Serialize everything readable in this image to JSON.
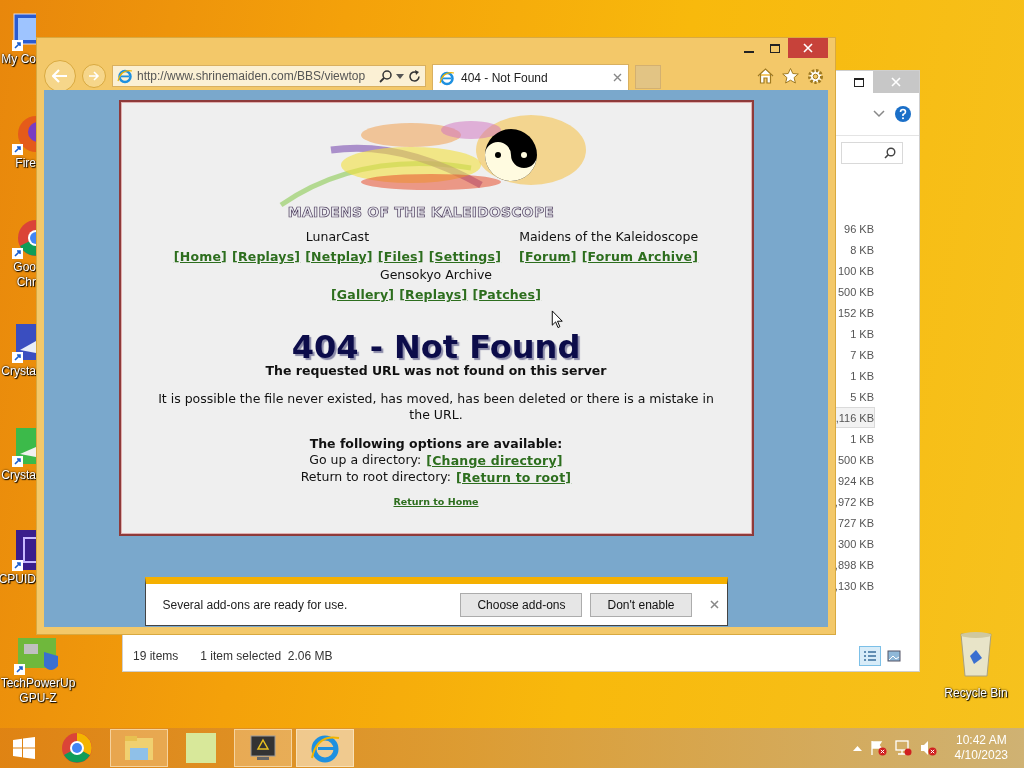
{
  "desktop": {
    "icons": [
      {
        "kind": "computer",
        "lines": [
          "My Co"
        ],
        "partly_hidden": true
      },
      {
        "kind": "firefox",
        "lines": [
          "Fire"
        ],
        "partly_hidden": true
      },
      {
        "kind": "chrome",
        "lines": [
          "Goo",
          "Chr"
        ],
        "partly_hidden": true
      },
      {
        "kind": "crystal-blue",
        "lines": [
          "Crysta"
        ],
        "partly_hidden": true
      },
      {
        "kind": "crystal-green",
        "lines": [
          "Crysta"
        ],
        "partly_hidden": true
      },
      {
        "kind": "cpuid",
        "lines": [
          "CPUID"
        ],
        "partly_hidden": true
      },
      {
        "kind": "gpuz",
        "lines": [
          "TechPowerUp",
          "GPU-Z"
        ],
        "partly_hidden": false
      }
    ],
    "recycle_bin": {
      "label": "Recycle Bin"
    }
  },
  "explorer": {
    "sizes": [
      {
        "text": "96 KB",
        "selected": false
      },
      {
        "text": "8 KB",
        "selected": false
      },
      {
        "text": "100 KB",
        "selected": false
      },
      {
        "text": "500 KB",
        "selected": false
      },
      {
        "text": "152 KB",
        "selected": false
      },
      {
        "text": "1 KB",
        "selected": false
      },
      {
        "text": "7 KB",
        "selected": false
      },
      {
        "text": "1 KB",
        "selected": false
      },
      {
        "text": "5 KB",
        "selected": false
      },
      {
        "text": ",116 KB",
        "selected": true
      },
      {
        "text": "1 KB",
        "selected": false
      },
      {
        "text": "500 KB",
        "selected": false
      },
      {
        "text": "924 KB",
        "selected": false
      },
      {
        "text": ",972 KB",
        "selected": false
      },
      {
        "text": "727 KB",
        "selected": false
      },
      {
        "text": "300 KB",
        "selected": false
      },
      {
        "text": ",898 KB",
        "selected": false
      },
      {
        "text": ",130 KB",
        "selected": false
      }
    ],
    "status_bar": {
      "item_count": "19 items",
      "selection": "1 item selected",
      "selection_size": "2.06 MB"
    },
    "views": [
      {
        "kind": "details",
        "selected": true
      },
      {
        "kind": "thumbnails",
        "selected": false
      }
    ]
  },
  "browser": {
    "address": "http://www.shrinemaiden.com/BBS/viewtop",
    "tabs": [
      {
        "title": "404 - Not Found",
        "selected": true
      }
    ],
    "page": {
      "logo_text": "MAIDENS OF THE KALEIDOSCOPE",
      "nav_groups": [
        {
          "title": "LunarCast",
          "links": [
            "[Home]",
            "[Replays]",
            "[Netplay]",
            "[Files]",
            "[Settings]"
          ]
        },
        {
          "title": "Maidens of the Kaleidoscope",
          "links": [
            "[Forum]",
            "[Forum Archive]"
          ]
        },
        {
          "title": "Gensokyo Archive",
          "links": [
            "[Gallery]",
            "[Replays]",
            "[Patches]"
          ]
        }
      ],
      "heading": "404 - Not Found",
      "subheading": "The requested URL was not found on this server",
      "message": "It is possible the file never existed, has moved, has been deleted or there is a mistake in the URL.",
      "options_title": "The following options are available:",
      "options": [
        {
          "label": "Go up a directory:",
          "link": "[Change directory]"
        },
        {
          "label": "Return to root directory:",
          "link": "[Return to root]"
        }
      ],
      "home_link": "Return to Home"
    },
    "notification": {
      "message": "Several add-ons are ready for use.",
      "buttons": [
        "Choose add-ons",
        "Don't enable"
      ]
    }
  },
  "taskbar": {
    "apps": [
      {
        "kind": "chrome",
        "open": false,
        "active": false
      },
      {
        "kind": "explorer",
        "open": true,
        "active": false
      },
      {
        "kind": "game",
        "open": false,
        "active": false
      },
      {
        "kind": "utility",
        "open": true,
        "active": false
      },
      {
        "kind": "ie",
        "open": true,
        "active": true
      }
    ],
    "clock": {
      "time": "10:42 AM",
      "date": "4/10/2023"
    }
  }
}
